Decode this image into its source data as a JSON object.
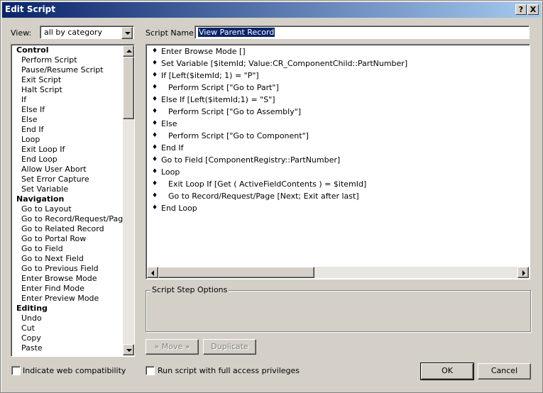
{
  "window": {
    "title": "Edit Script",
    "help_button": "?",
    "close_button": "X"
  },
  "view": {
    "label": "View:",
    "selected": "all by category"
  },
  "script_name": {
    "label": "Script Name:",
    "value": "View Parent Record"
  },
  "steps_list": [
    {
      "text": "Control",
      "type": "category"
    },
    {
      "text": "Perform Script",
      "type": "step"
    },
    {
      "text": "Pause/Resume Script",
      "type": "step"
    },
    {
      "text": "Exit Script",
      "type": "step"
    },
    {
      "text": "Halt Script",
      "type": "step"
    },
    {
      "text": "If",
      "type": "step"
    },
    {
      "text": "Else If",
      "type": "step"
    },
    {
      "text": "Else",
      "type": "step"
    },
    {
      "text": "End If",
      "type": "step"
    },
    {
      "text": "Loop",
      "type": "step"
    },
    {
      "text": "Exit Loop If",
      "type": "step"
    },
    {
      "text": "End Loop",
      "type": "step"
    },
    {
      "text": "Allow User Abort",
      "type": "step"
    },
    {
      "text": "Set Error Capture",
      "type": "step"
    },
    {
      "text": "Set Variable",
      "type": "step"
    },
    {
      "text": "Navigation",
      "type": "category"
    },
    {
      "text": "Go to Layout",
      "type": "step"
    },
    {
      "text": "Go to Record/Request/Page",
      "type": "step"
    },
    {
      "text": "Go to Related Record",
      "type": "step"
    },
    {
      "text": "Go to Portal Row",
      "type": "step"
    },
    {
      "text": "Go to Field",
      "type": "step"
    },
    {
      "text": "Go to Next Field",
      "type": "step"
    },
    {
      "text": "Go to Previous Field",
      "type": "step"
    },
    {
      "text": "Enter Browse Mode",
      "type": "step"
    },
    {
      "text": "Enter Find Mode",
      "type": "step"
    },
    {
      "text": "Enter Preview Mode",
      "type": "step"
    },
    {
      "text": "Editing",
      "type": "category"
    },
    {
      "text": "Undo",
      "type": "step"
    },
    {
      "text": "Cut",
      "type": "step"
    },
    {
      "text": "Copy",
      "type": "step"
    },
    {
      "text": "Paste",
      "type": "step"
    }
  ],
  "script_lines": [
    {
      "text": "Enter Browse Mode []",
      "indent": 0
    },
    {
      "text": "Set Variable [$itemId; Value:CR_ComponentChild::PartNumber]",
      "indent": 0
    },
    {
      "text": "If [Left($itemId; 1) = \"P\"]",
      "indent": 0
    },
    {
      "text": "Perform Script [\"Go to Part\"]",
      "indent": 1
    },
    {
      "text": "Else If [Left($itemId;1) = \"S\"]",
      "indent": 0
    },
    {
      "text": "Perform Script [\"Go to Assembly\"]",
      "indent": 1
    },
    {
      "text": "Else",
      "indent": 0
    },
    {
      "text": "Perform Script [\"Go to Component\"]",
      "indent": 1
    },
    {
      "text": "End If",
      "indent": 0
    },
    {
      "text": "Go to Field [ComponentRegistry::PartNumber]",
      "indent": 0
    },
    {
      "text": "Loop",
      "indent": 0
    },
    {
      "text": "Exit Loop If [Get ( ActiveFieldContents ) = $itemId]",
      "indent": 1
    },
    {
      "text": "Go to Record/Request/Page [Next; Exit after last]",
      "indent": 1
    },
    {
      "text": "End Loop",
      "indent": 0
    }
  ],
  "step_options": {
    "label": "Script Step Options"
  },
  "buttons": {
    "move": "» Move »",
    "duplicate": "Duplicate",
    "ok": "OK",
    "cancel": "Cancel"
  },
  "checkboxes": {
    "web_compat": "Indicate web compatibility",
    "full_access": "Run script with full access privileges"
  },
  "colors": {
    "title_start": "#0a246a",
    "title_end": "#a6caf0",
    "selection": "#0a246a"
  }
}
